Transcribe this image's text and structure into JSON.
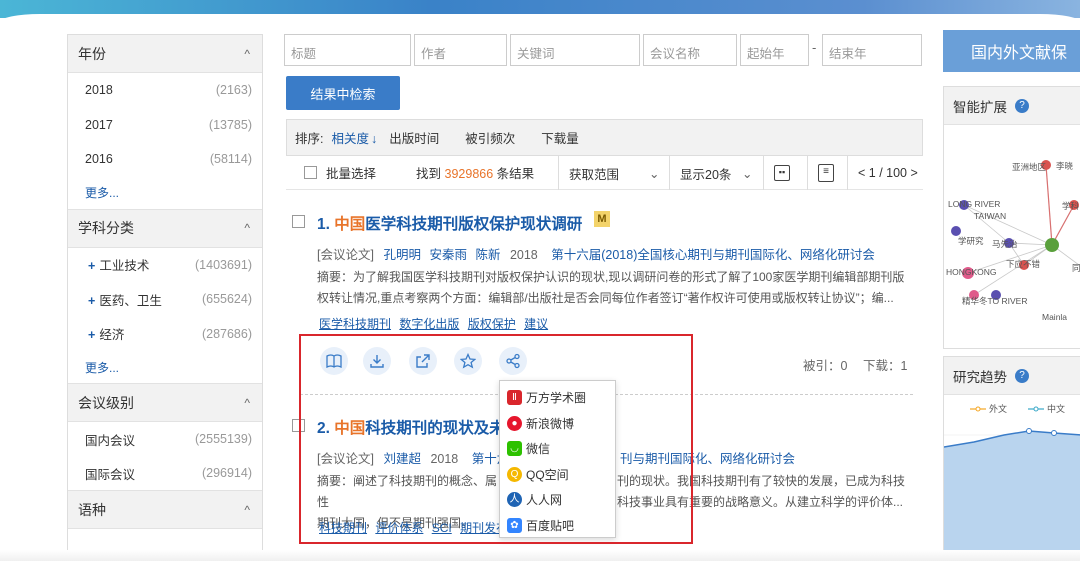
{
  "sidebar": {
    "sections": [
      {
        "title": "年份",
        "items": [
          {
            "label": "2018",
            "count": "(2163)"
          },
          {
            "label": "2017",
            "count": "(13785)"
          },
          {
            "label": "2016",
            "count": "(58114)"
          }
        ],
        "more": "更多..."
      },
      {
        "title": "学科分类",
        "items": [
          {
            "label": "工业技术",
            "count": "(1403691)"
          },
          {
            "label": "医药、卫生",
            "count": "(655624)"
          },
          {
            "label": "经济",
            "count": "(287686)"
          }
        ],
        "more": "更多..."
      },
      {
        "title": "会议级别",
        "items": [
          {
            "label": "国内会议",
            "count": "(2555139)"
          },
          {
            "label": "国际会议",
            "count": "(296914)"
          }
        ]
      },
      {
        "title": "语种"
      }
    ],
    "chevron": "^",
    "plus": "+"
  },
  "search": {
    "fields": [
      "标题",
      "作者",
      "关键词",
      "会议名称",
      "起始年",
      "结束年"
    ],
    "dash": "-",
    "button": "结果中检索"
  },
  "sortbar": {
    "label": "排序:",
    "options": [
      "相关度",
      "出版时间",
      "被引频次",
      "下载量"
    ],
    "active_arrow": "↓"
  },
  "toolbar": {
    "batch": "批量选择",
    "found_prefix": "找到",
    "found_num": "3929866",
    "found_suffix": "条结果",
    "scope": "获取范围",
    "per_page": "显示20条",
    "pager": "< 1 / 100 >"
  },
  "results": [
    {
      "num": "1.",
      "title_hl": "中国",
      "title_rest": "医学科技期刊版权保护现状调研",
      "badge": "M",
      "type": "[会议论文]",
      "authors": [
        "孔明明",
        "安秦雨",
        "陈新"
      ],
      "year": "2018",
      "venue": "第十六届(2018)全国核心期刊与期刊国际化、网络化研讨会",
      "abstract1": "摘要：为了解我国医学科技期刊对版权保护认识的现状,现以调研问卷的形式了解了100家医学期刊编辑部期刊版",
      "abstract2": "权转让情况,重点考察两个方面：编辑部/出版社是否会同每位作者签订“著作权许可使用或版权转让协议”；编...",
      "keywords": [
        "医学科技期刊",
        "数字化出版",
        "版权保护",
        "建议"
      ],
      "cited": "被引：0",
      "downloads": "下载：1"
    },
    {
      "num": "2.",
      "title_hl": "中国",
      "title_rest": "科技期刊的现状及未",
      "type": "[会议论文]",
      "authors": [
        "刘建超"
      ],
      "year": "2018",
      "venue_left": "第十六",
      "venue_right": "刊与期刊国际化、网络化研讨会",
      "abstract1_left": "摘要：阐述了科技期刊的概念、属性",
      "abstract1_right": "刊的现状。我国科技期刊有了较快的发展，已成为科技",
      "abstract2_left": "期刊大国，但不是期刊强国。",
      "abstract2_right": "科技事业具有重要的战略意义。从建立科学的评价体...",
      "keywords": [
        "科技期刊",
        "评价体系",
        "SCI",
        "期刊发布"
      ]
    }
  ],
  "share_menu": {
    "items": [
      {
        "label": "万方学术圈",
        "icon": "wanfang-icon",
        "color": "#d9262c"
      },
      {
        "label": "新浪微博",
        "icon": "weibo-icon",
        "color": "#e6162d"
      },
      {
        "label": "微信",
        "icon": "wechat-icon",
        "color": "#2dc100"
      },
      {
        "label": "QQ空间",
        "icon": "qzone-icon",
        "color": "#f5b800"
      },
      {
        "label": "人人网",
        "icon": "renren-icon",
        "color": "#1f64b4"
      },
      {
        "label": "百度贴吧",
        "icon": "tieba-icon",
        "color": "#3385ff"
      }
    ]
  },
  "right": {
    "header": "国内外文献保",
    "smart_title": "智能扩展",
    "trend_title": "研究趋势",
    "help": "?",
    "network_labels": [
      "亚洲地区",
      "李晓",
      "学科",
      "LONG RIVER",
      "TAIWAN",
      "学研究",
      "马先治",
      "HONGKONG",
      "下应不错",
      "同",
      "精华冬TO RIVER",
      "Mainla"
    ],
    "legend": [
      "外文",
      "中文"
    ]
  },
  "colors": {
    "accent": "#3a7cc8",
    "link": "#1a5ba8",
    "highlight": "#e8742a",
    "redbox": "#d9262c"
  }
}
